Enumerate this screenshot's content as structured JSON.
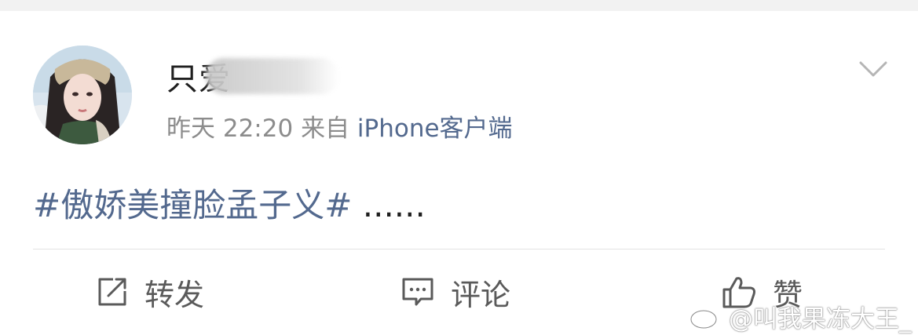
{
  "post": {
    "user": {
      "name_visible": "只爱",
      "avatar_icon": "profile-photo"
    },
    "meta": {
      "time": "昨天 22:20",
      "from_label": "来自",
      "source": "iPhone客户端"
    },
    "text": {
      "hashtag": "#傲娇美撞脸孟子义#",
      "rest": " ......"
    },
    "actions": {
      "repost_label": "转发",
      "comment_label": "评论",
      "like_label": "赞"
    }
  },
  "watermark": {
    "text": "@叫我果冻大王_"
  },
  "colors": {
    "link": "#53698e",
    "text": "#1f1f1f",
    "meta": "#8c8c8c",
    "action": "#5a5a5a"
  }
}
